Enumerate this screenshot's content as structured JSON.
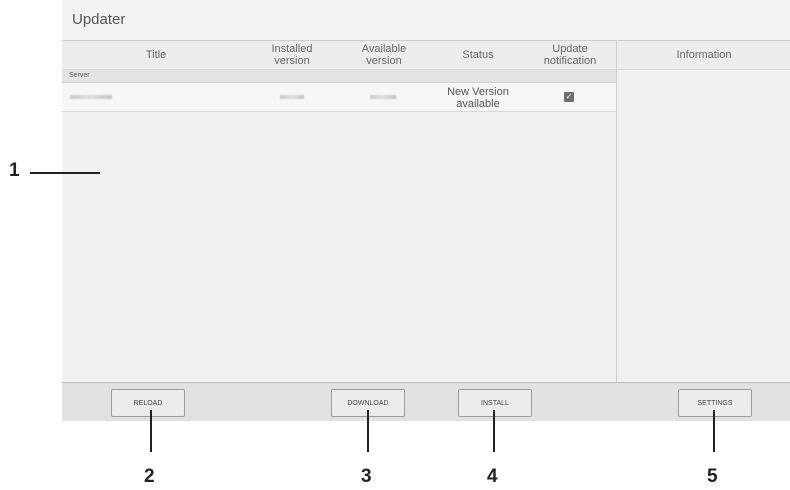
{
  "app": {
    "title": "Updater"
  },
  "table": {
    "headers": {
      "title": "Title",
      "installed": "Installed\nversion",
      "available": "Available\nversion",
      "status": "Status",
      "notification": "Update\nnotification"
    },
    "group_label": "Server",
    "rows": [
      {
        "status": "New Version\navailable",
        "notification_checked": true
      }
    ]
  },
  "info": {
    "header": "Information"
  },
  "buttons": {
    "reload": "RELOAD",
    "download": "DOWNLOAD",
    "install": "INSTALL",
    "settings": "SETTINGS"
  },
  "callouts": {
    "c1": "1",
    "c2": "2",
    "c3": "3",
    "c4": "4",
    "c5": "5"
  },
  "icons": {
    "checkbox": "check-icon"
  }
}
